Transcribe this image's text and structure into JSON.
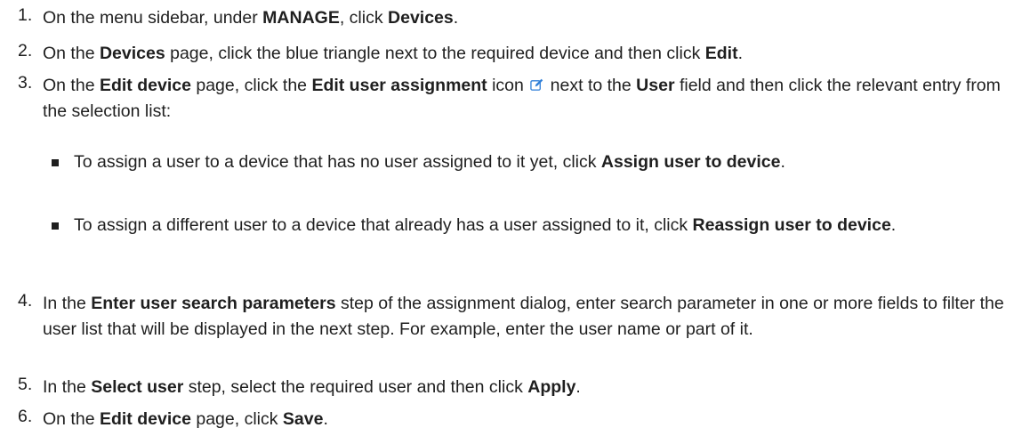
{
  "steps": [
    {
      "number": "1.",
      "parts": [
        "On the menu sidebar, under ",
        "MANAGE",
        ", click ",
        "Devices",
        "."
      ]
    },
    {
      "number": "2.",
      "parts": [
        "On the ",
        "Devices",
        " page, click the blue triangle next to the required device and then click ",
        "Edit",
        "."
      ]
    },
    {
      "number": "3.",
      "parts": [
        "On the ",
        "Edit device",
        " page, click the ",
        "Edit user assignment",
        " icon ",
        " next to the ",
        "User",
        " field and then click the relevant entry from the selection list:"
      ]
    },
    {
      "number": "4.",
      "parts": [
        "In the ",
        "Enter user search parameters",
        " step of the assignment dialog, enter search parameter in one or more fields to filter the user list that will be displayed in the next step. For example, enter the user name or part of it."
      ]
    },
    {
      "number": "5.",
      "parts": [
        "In the ",
        "Select user",
        " step, select the required user and then click ",
        "Apply",
        "."
      ]
    },
    {
      "number": "6.",
      "parts": [
        "On the ",
        "Edit device",
        " page, click ",
        "Save",
        "."
      ]
    }
  ],
  "bullets": [
    {
      "parts": [
        "To assign a user to a device that has no user assigned to it yet, click ",
        "Assign user to device",
        "."
      ]
    },
    {
      "parts": [
        "To assign a different user to a device that already has a user assigned to it, click ",
        "Reassign user to device",
        "."
      ]
    }
  ],
  "icons": {
    "edit_user_assignment": "edit-pencil-icon"
  },
  "colors": {
    "text": "#1f1f1f",
    "icon": "#2f7fd8"
  }
}
